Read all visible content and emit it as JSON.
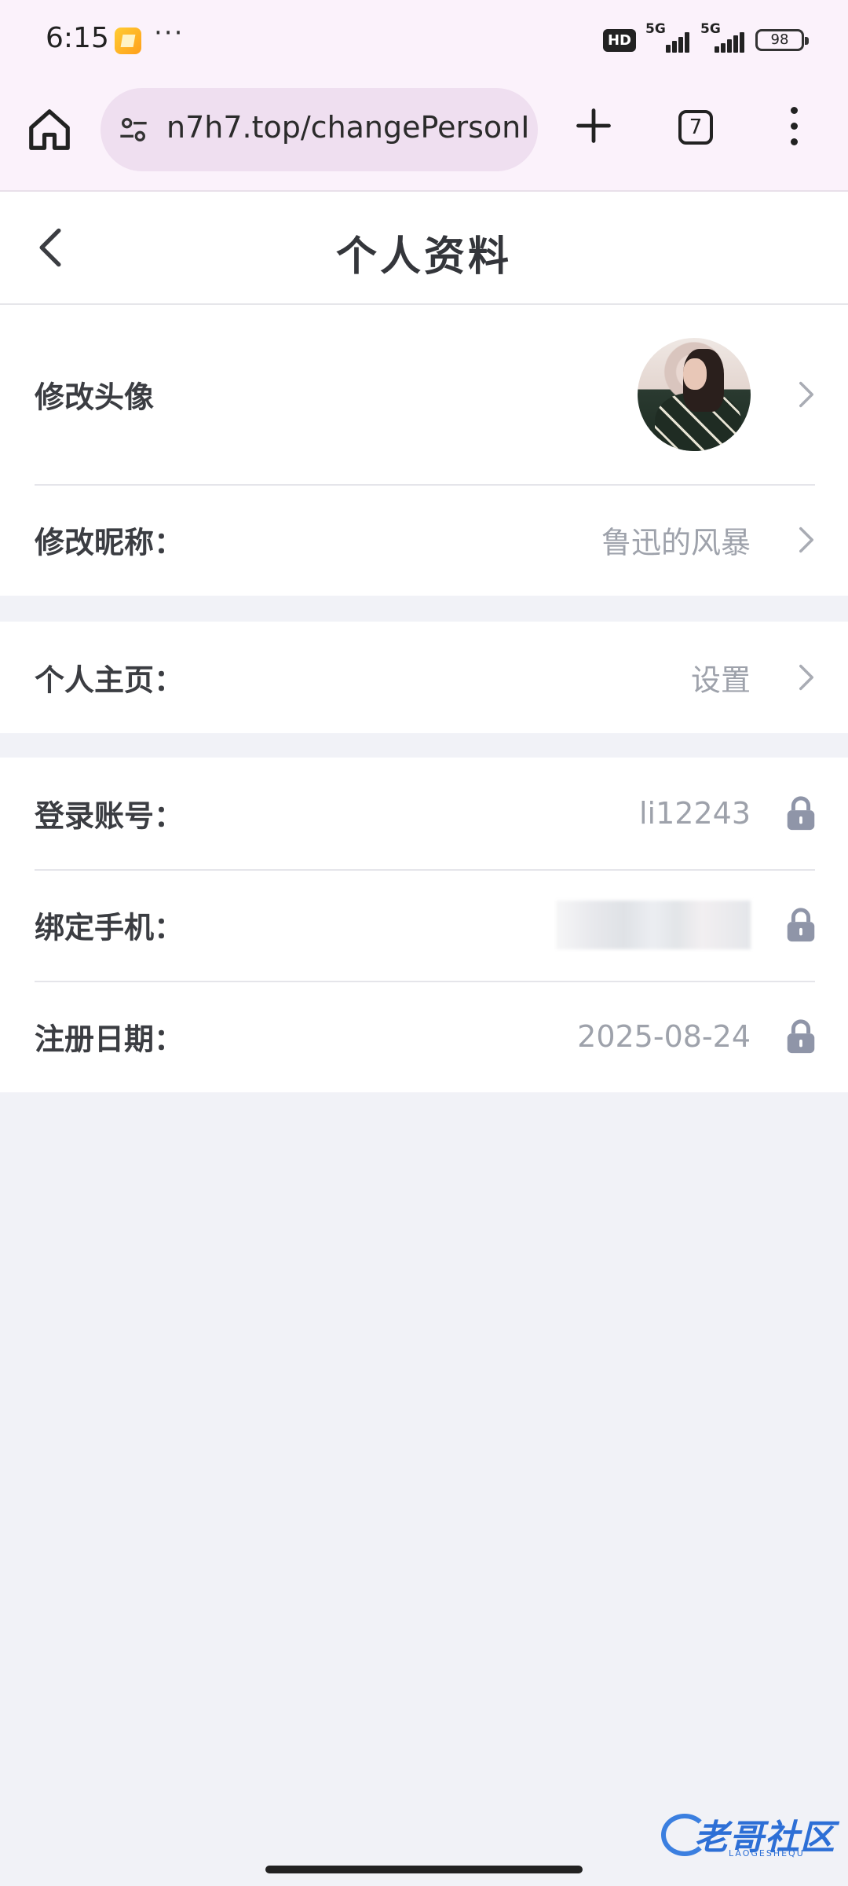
{
  "status_bar": {
    "time": "6:15",
    "dots": "···",
    "hd": "HD",
    "sim1": "5G",
    "sim2": "5G",
    "battery": "98"
  },
  "browser": {
    "url": "n7h7.top/changePersonI",
    "tab_count": "7"
  },
  "page": {
    "title": "个人资料"
  },
  "profile": {
    "avatar_label": "修改头像",
    "nickname_label": "修改昵称：",
    "nickname_value": "鲁迅的风暴",
    "homepage_label": "个人主页：",
    "homepage_value": "设置",
    "account_label": "登录账号：",
    "account_value": "li12243",
    "phone_label": "绑定手机：",
    "register_label": "注册日期：",
    "register_value": "2025-08-24"
  },
  "watermark": {
    "title": "老哥社区",
    "subtitle": "LAOGESHEQU"
  }
}
